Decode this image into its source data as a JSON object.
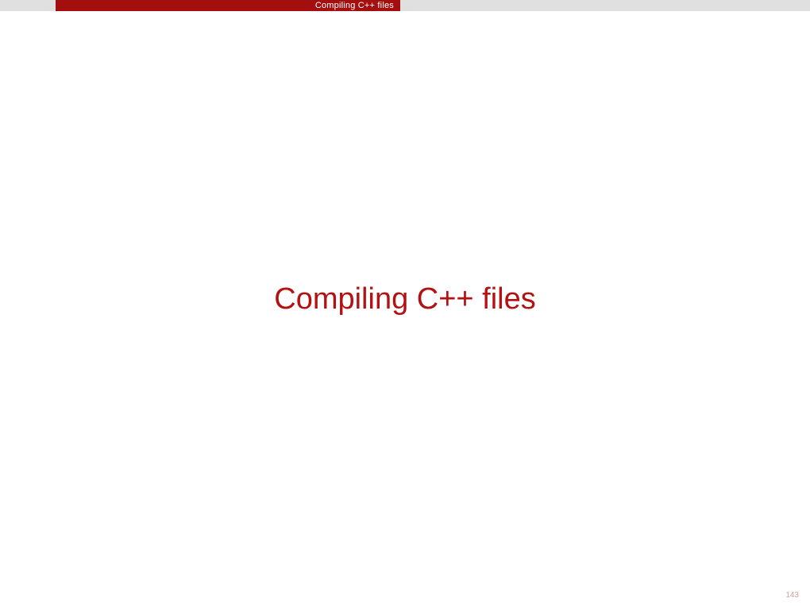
{
  "header": {
    "section_label": "Compiling C++ files"
  },
  "main": {
    "title": "Compiling C++ files"
  },
  "footer": {
    "page_number": "143"
  }
}
